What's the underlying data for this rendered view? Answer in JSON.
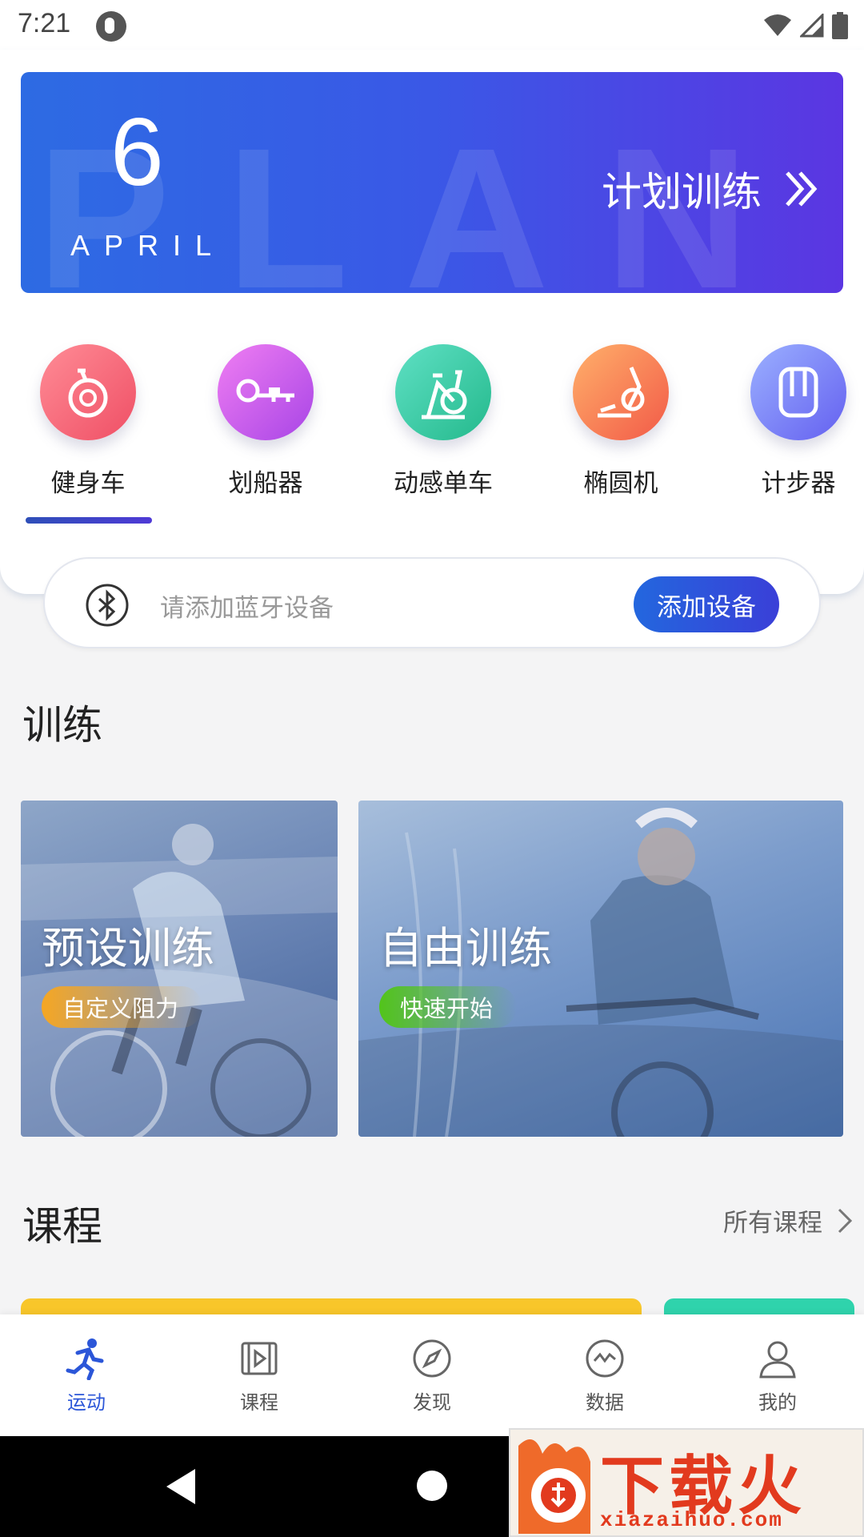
{
  "status_bar": {
    "time": "7:21",
    "icons": [
      "app-notification-icon",
      "wifi-icon",
      "cellular-signal-icon",
      "battery-icon"
    ]
  },
  "plan_banner": {
    "day": "6",
    "month": "APRIL",
    "watermark": "PLAN",
    "link_label": "计划训练",
    "link_icon": "double-chevron-right-icon"
  },
  "devices": {
    "selected_index": 0,
    "items": [
      {
        "label": "健身车",
        "icon": "exercise-bike-icon",
        "gradient": [
          "#ff7b8a",
          "#f2566a"
        ]
      },
      {
        "label": "划船器",
        "icon": "rowing-machine-icon",
        "gradient": [
          "#e06cf0",
          "#b04ce8"
        ]
      },
      {
        "label": "动感单车",
        "icon": "spin-bike-icon",
        "gradient": [
          "#4fd6ba",
          "#2dbf94"
        ]
      },
      {
        "label": "椭圆机",
        "icon": "elliptical-icon",
        "gradient": [
          "#ffa864",
          "#f4644c"
        ]
      },
      {
        "label": "计步器",
        "icon": "pedometer-icon",
        "gradient": [
          "#8aa0ff",
          "#6a6cf0"
        ]
      }
    ]
  },
  "bluetooth": {
    "icon": "bluetooth-icon",
    "placeholder": "请添加蓝牙设备",
    "add_button": "添加设备"
  },
  "training": {
    "title": "训练",
    "cards": [
      {
        "title": "预设训练",
        "tag": "自定义阻力",
        "tag_color": "#f5a623"
      },
      {
        "title": "自由训练",
        "tag": "快速开始",
        "tag_color": "#52c41a"
      }
    ]
  },
  "courses": {
    "title": "课程",
    "more_label": "所有课程"
  },
  "bottom_nav": {
    "active_index": 0,
    "items": [
      {
        "label": "运动",
        "icon": "running-icon"
      },
      {
        "label": "课程",
        "icon": "video-course-icon"
      },
      {
        "label": "发现",
        "icon": "compass-icon"
      },
      {
        "label": "数据",
        "icon": "data-chart-icon"
      },
      {
        "label": "我的",
        "icon": "profile-icon"
      }
    ]
  },
  "watermark_logo": {
    "text": "下载火",
    "sub": "xiazaihuo.com"
  },
  "colors": {
    "accent": "#2b56d8",
    "banner_start": "#2d6be3",
    "banner_end": "#5b36e2"
  }
}
